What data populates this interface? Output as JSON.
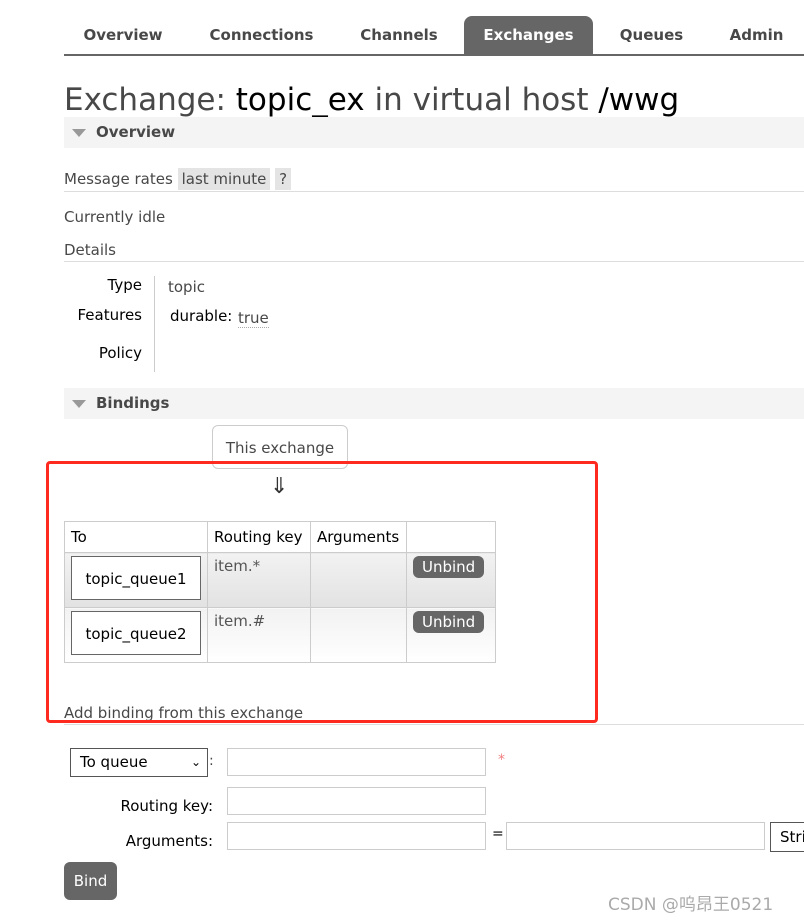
{
  "nav": {
    "tabs": [
      {
        "label": "Overview",
        "active": false
      },
      {
        "label": "Connections",
        "active": false
      },
      {
        "label": "Channels",
        "active": false
      },
      {
        "label": "Exchanges",
        "active": true
      },
      {
        "label": "Queues",
        "active": false
      },
      {
        "label": "Admin",
        "active": false
      }
    ]
  },
  "title": {
    "prefix": "Exchange: ",
    "name": "topic_ex",
    "mid": " in virtual host ",
    "vhost": "/wwg"
  },
  "overview": {
    "heading": "Overview",
    "rates_label": "Message rates",
    "rates_value": "last minute",
    "help": "?",
    "idle": "Currently idle",
    "details": "Details",
    "type_label": "Type",
    "type_value": "topic",
    "features_label": "Features",
    "durable_label": "durable:",
    "durable_value": "true",
    "policy_label": "Policy"
  },
  "bindings": {
    "heading": "Bindings",
    "this_exchange": "This exchange",
    "arrow": "⇓",
    "columns": [
      "To",
      "Routing key",
      "Arguments",
      ""
    ],
    "rows": [
      {
        "to": "topic_queue1",
        "routing_key": "item.*",
        "arguments": "",
        "action": "Unbind"
      },
      {
        "to": "topic_queue2",
        "routing_key": "item.#",
        "arguments": "",
        "action": "Unbind"
      }
    ]
  },
  "add_binding": {
    "heading": "Add binding from this exchange",
    "destination_select": "To queue",
    "colon": ":",
    "required": "*",
    "routing_key_label": "Routing key:",
    "arguments_label": "Arguments:",
    "equals": "=",
    "type_select": "String",
    "bind_label": "Bind"
  },
  "annotation_color": "#ff2a1f",
  "watermark": "CSDN @呜昂王0521"
}
